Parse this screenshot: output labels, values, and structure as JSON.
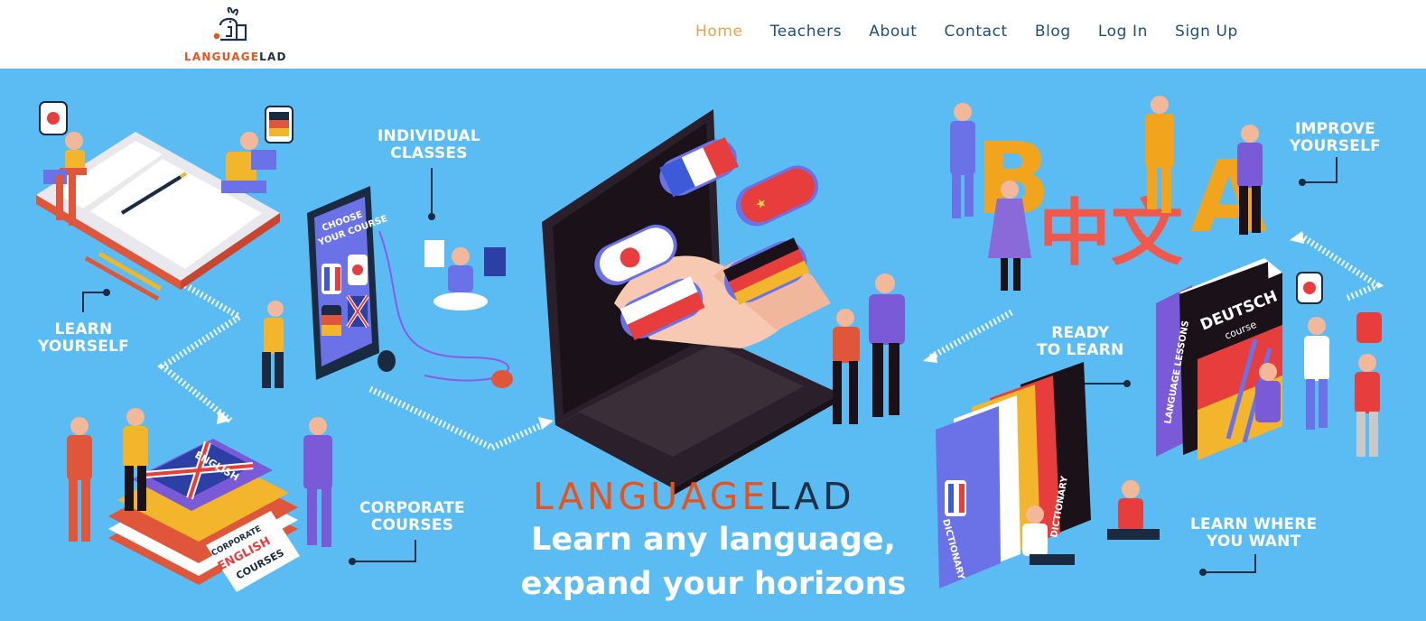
{
  "header": {
    "logo": {
      "part1": "LANGUAGE",
      "part2": "LAD",
      "color1": "#e8531c",
      "color2": "#1f2f45"
    },
    "nav": [
      {
        "label": "Home",
        "active": true
      },
      {
        "label": "Teachers",
        "active": false
      },
      {
        "label": "About",
        "active": false
      },
      {
        "label": "Contact",
        "active": false
      },
      {
        "label": "Blog",
        "active": false
      },
      {
        "label": "Log In",
        "active": false
      },
      {
        "label": "Sign Up",
        "active": false
      }
    ],
    "colors": {
      "nav_text": "#1f4e79",
      "nav_active": "#f0a046"
    }
  },
  "hero": {
    "background": "#5bbcf3",
    "labels": {
      "individual_classes": [
        "INDIVIDUAL",
        "CLASSES"
      ],
      "learn_yourself": [
        "LEARN",
        "YOURSELF"
      ],
      "corporate_courses": [
        "CORPORATE",
        "COURSES"
      ],
      "improve_yourself": [
        "IMPROVE",
        "YOURSELF"
      ],
      "ready_to_learn": [
        "READY",
        "TO LEARN"
      ],
      "learn_where": [
        "LEARN WHERE",
        "YOU WANT"
      ]
    },
    "illustration_text": {
      "phone": [
        "CHOOSE",
        "YOUR COURSE"
      ],
      "english_book": "ENGLISH",
      "corporate_book": [
        "CORPORATE",
        "ENGLISH",
        "COURSES"
      ],
      "deutsch_book": [
        "DEUTSCH",
        "course"
      ],
      "language_lessons": "LANGUAGE LESSONS",
      "dictionary_1": "DICTIONARY",
      "dictionary_2": "DICTIONARY",
      "letter_b": "B",
      "letter_a": "A",
      "chinese": "中文"
    },
    "brand": {
      "part1": "LANGUAGE",
      "part2": "LAD",
      "color1": "#e8531c",
      "color2": "#1f2f45"
    },
    "tagline": [
      "Learn any language,",
      "expand your horizons"
    ]
  }
}
